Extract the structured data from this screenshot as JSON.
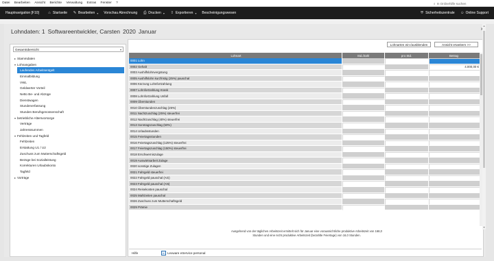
{
  "menu": [
    "Datei",
    "Bearbeiten",
    "Ansicht",
    "Berichte",
    "Verwaltung",
    "Extras",
    "Fenster",
    "?"
  ],
  "search": {
    "placeholder": "In Onlinehilfe suchen"
  },
  "toolbar": {
    "hauptnavigation": "Hauptnavigation [F10]",
    "startseite": "Startseite",
    "bearbeiten": "Bearbeiten",
    "vorschau": "Vorschau Abrechnung",
    "drucken": "Drucken",
    "exportieren": "Exportieren",
    "bescheinigung": "Bescheinigungswesen",
    "sicherheit": "Sicherheitszentrale",
    "support": "Online Support"
  },
  "page": {
    "title_prefix": "Lohndaten: 1",
    "employee": "Softwareentwickler, Carsten",
    "year": "2020",
    "month": "Januar"
  },
  "sidebar": {
    "select_value": "Gesamtübersicht",
    "tree": [
      {
        "label": "Stammdaten",
        "level": 0,
        "toggle": "▸"
      },
      {
        "label": "Lohnangaben",
        "level": 0,
        "toggle": "▾"
      },
      {
        "label": "Laufendes Arbeitsentgelt",
        "level": 1,
        "active": true
      },
      {
        "label": "Einmalbildung",
        "level": 1
      },
      {
        "label": "VWL",
        "level": 1
      },
      {
        "label": "Geldwerter Vorteil",
        "level": 1
      },
      {
        "label": "Netto Be- und Abzüge",
        "level": 1
      },
      {
        "label": "Dienstwagen",
        "level": 1
      },
      {
        "label": "Stundenerfassung",
        "level": 1
      },
      {
        "label": "Stunden Berufsgenossenschaft",
        "level": 1
      },
      {
        "label": "betriebliche Altersvorsorge",
        "level": 0,
        "toggle": "▾"
      },
      {
        "label": "Verträge",
        "level": 1
      },
      {
        "label": "Jahresssummen",
        "level": 1
      },
      {
        "label": "Fehlzeiten und Tagfeld",
        "level": 0,
        "toggle": "▾"
      },
      {
        "label": "Fehlzeiten",
        "level": 1
      },
      {
        "label": "Erstattung U1 / U2",
        "level": 1
      },
      {
        "label": "Zuschuss zum Mutterschaftsgeld",
        "level": 1
      },
      {
        "label": "Bezüge bei Sozialleistung",
        "level": 1
      },
      {
        "label": "Korrekturen Urlaubskonto",
        "level": 1
      },
      {
        "label": "Tagfeld",
        "level": 1
      },
      {
        "label": "Vorträge",
        "level": 0,
        "toggle": "▸"
      }
    ]
  },
  "main": {
    "btn_lohnarten": "Lohnarten ein-/ausblenden",
    "btn_ansicht": "Ansicht erweitern >>",
    "headers": [
      "Lohnart",
      "Std./Zahl",
      "pro Std.",
      "Betrag"
    ],
    "rows": [
      {
        "label": "0001 Lohn",
        "betrag": "",
        "selected": true
      },
      {
        "label": "0002 Gehalt",
        "betrag": "4.000,00 €"
      },
      {
        "label": "0003 Aushilfslohnvergütung",
        "betrag": ""
      },
      {
        "label": "0005 Aushilfslohn kurzfristig (25%) pauschal",
        "betrag": ""
      },
      {
        "label": "0006 Kürzung Lohnfortzahlung",
        "betrag": ""
      },
      {
        "label": "0007 Lohnfortzahlung Krank",
        "betrag": ""
      },
      {
        "label": "0008 Lohnfortzahlung Unfall",
        "betrag": ""
      },
      {
        "label": "0009 Überstunden",
        "betrag": ""
      },
      {
        "label": "0010 Überstundenzuschlag (25%)",
        "betrag": ""
      },
      {
        "label": "0011 Nachtzuschlag (25%) steuerfrei",
        "betrag": ""
      },
      {
        "label": "0012 Nachtzuschlag (40%) steuerfrei",
        "betrag": ""
      },
      {
        "label": "0013 Sonntagszuschlag (50%)",
        "betrag": ""
      },
      {
        "label": "0014 Urlaubsstunden",
        "betrag": ""
      },
      {
        "label": "0015 Feiertagsstunden",
        "betrag": ""
      },
      {
        "label": "0016 Feiertagszuschlag (125%) steuerfrei",
        "betrag": ""
      },
      {
        "label": "0017 Feiertagszuschlag (150%) steuerfrei",
        "betrag": ""
      },
      {
        "label": "0018 Erschwerniszulage",
        "betrag": ""
      },
      {
        "label": "0019 Auswärtsarbeit Zulage",
        "betrag": ""
      },
      {
        "label": "0020 sonstige Zulagen",
        "betrag": ""
      },
      {
        "label": "0021 Fahrgeld steuerfrei",
        "betrag": ""
      },
      {
        "label": "0022 Fahrgeld pauschal (AG)",
        "betrag": ""
      },
      {
        "label": "0023 Fahrgeld pauschal (AN)",
        "betrag": ""
      },
      {
        "label": "0024 Reisekosten pauschal",
        "betrag": ""
      },
      {
        "label": "0025 Mahlzeiten pauschal",
        "betrag": ""
      },
      {
        "label": "0026 Zuschuss zum Mutterschaftsgeld",
        "betrag": ""
      },
      {
        "label": "0029 Prämie",
        "betrag": ""
      }
    ],
    "note": "Ausgehend von der täglichen Arbeitszeit ermittelt sich für Januar eine voraussichtliche produktive Arbeitszeit von 168,0 Stunden und eine nicht produktive Arbeitszeit (bezahlte Feiertage) von 16,0 Stunden.",
    "footer_hilfe": "Hilfe",
    "footer_eservice": "Lexware eService personal"
  },
  "colors": {
    "accent": "#2a86d6",
    "toolbar": "#1c1c1c"
  }
}
